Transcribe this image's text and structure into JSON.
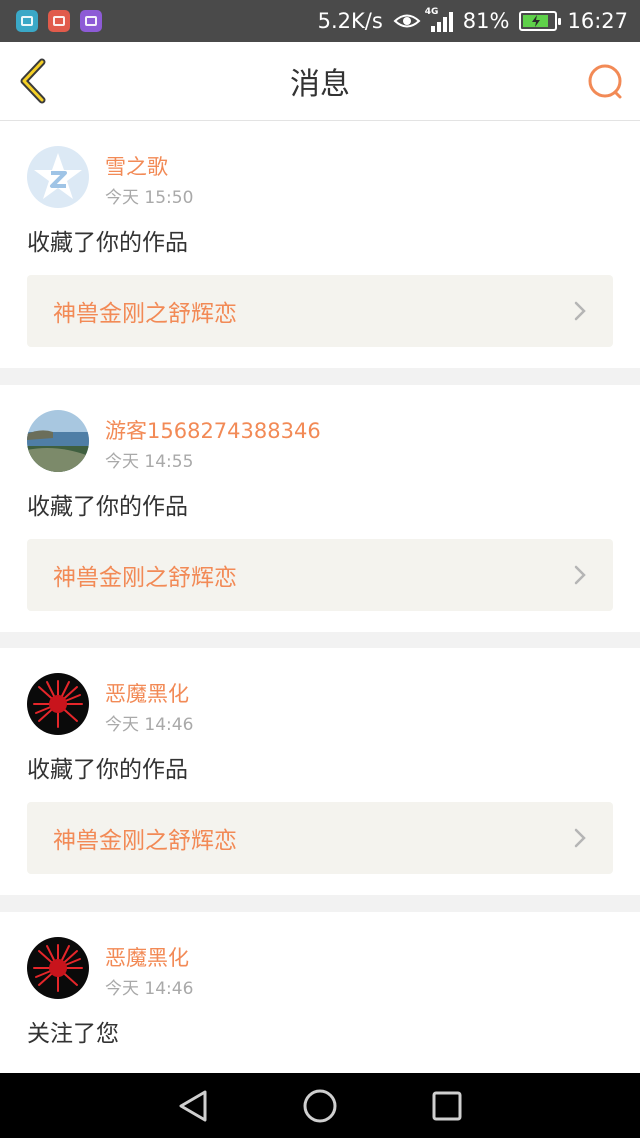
{
  "status_bar": {
    "net_speed": "5.2K/s",
    "network_type": "4G",
    "battery_percent": "81%",
    "time": "16:27",
    "app_icons": [
      {
        "name": "app-icon-teal",
        "color": "#3aa8c7"
      },
      {
        "name": "app-icon-red",
        "color": "#e15b4b"
      },
      {
        "name": "app-icon-purple",
        "color": "#8d5bd6"
      }
    ],
    "battery_color": "#5fd14a"
  },
  "header": {
    "title": "消息",
    "back_icon": "chevron-left-icon",
    "search_icon": "search-icon",
    "accent_color": "#f28a56"
  },
  "messages": [
    {
      "username": "雪之歌",
      "time": "今天 15:50",
      "action": "收藏了你的作品",
      "work_title": "神兽金刚之舒辉恋",
      "avatar": "default-avatar"
    },
    {
      "username": "游客1568274388346",
      "time": "今天 14:55",
      "action": "收藏了你的作品",
      "work_title": "神兽金刚之舒辉恋",
      "avatar": "seascape-avatar"
    },
    {
      "username": "恶魔黑化",
      "time": "今天 14:46",
      "action": "收藏了你的作品",
      "work_title": "神兽金刚之舒辉恋",
      "avatar": "red-flower-avatar"
    },
    {
      "username": "恶魔黑化",
      "time": "今天 14:46",
      "action": "关注了您",
      "avatar": "red-flower-avatar"
    }
  ],
  "nav_bar": {
    "buttons": [
      "back-triangle-icon",
      "home-circle-icon",
      "recents-square-icon"
    ]
  }
}
